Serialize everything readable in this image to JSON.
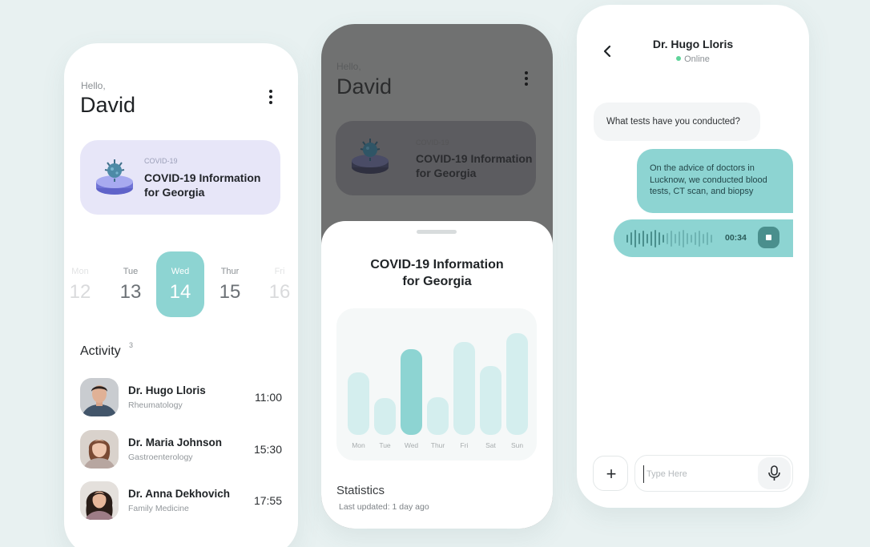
{
  "colors": {
    "accent": "#8dd4d2",
    "accent_dark": "#4a8f8d",
    "card_lavender": "#e7e6f8",
    "online": "#5fd49a",
    "background": "#e8f1f1"
  },
  "home": {
    "greeting": "Hello,",
    "user_name": "David",
    "menu_icon": "more-vertical-icon",
    "covid_card": {
      "icon": "virus-icon",
      "label": "COVID-19",
      "title": "COVID-19 Information for Georgia"
    },
    "days": [
      {
        "name": "Mon",
        "num": "12",
        "state": "faded"
      },
      {
        "name": "Tue",
        "num": "13",
        "state": "normal"
      },
      {
        "name": "Wed",
        "num": "14",
        "state": "active"
      },
      {
        "name": "Thur",
        "num": "15",
        "state": "normal"
      },
      {
        "name": "Fri",
        "num": "16",
        "state": "faded"
      }
    ],
    "activity": {
      "title": "Activity",
      "count": "3",
      "items": [
        {
          "name": "Dr. Hugo Lloris",
          "specialty": "Rheumatology",
          "time": "11:00"
        },
        {
          "name": "Dr. Maria Johnson",
          "specialty": "Gastroenterology",
          "time": "15:30"
        },
        {
          "name": "Dr. Anna Dekhovich",
          "specialty": "Family Medicine",
          "time": "17:55"
        }
      ]
    }
  },
  "sheet": {
    "title_line1": "COVID-19 Information",
    "title_line2": "for Georgia",
    "stats_title": "Statistics",
    "stats_updated": "Last updated: 1 day ago"
  },
  "chart_data": {
    "type": "bar",
    "categories": [
      "Mon",
      "Tue",
      "Wed",
      "Thur",
      "Fri",
      "Sat",
      "Sun"
    ],
    "values": [
      78,
      46,
      107,
      47,
      116,
      86,
      127
    ],
    "highlight": "Wed",
    "title": "",
    "xlabel": "",
    "ylabel": "",
    "grid": false
  },
  "chat": {
    "back_icon": "chevron-left-icon",
    "contact_name": "Dr. Hugo Lloris",
    "status": "Online",
    "messages": [
      {
        "from": "doctor",
        "text": "What tests have you conducted?"
      },
      {
        "from": "me",
        "text": "On the advice of doctors in Lucknow, we conducted blood tests, CT scan, and biopsy"
      }
    ],
    "voice_message": {
      "duration": "00:34",
      "icon": "stop-icon",
      "waveform": [
        10,
        16,
        22,
        14,
        20,
        12,
        18,
        22,
        16,
        10,
        14,
        20,
        12,
        18,
        22,
        14,
        10,
        16,
        20,
        12,
        16,
        10
      ]
    },
    "add_icon": "plus-icon",
    "input_placeholder": "Type Here",
    "mic_icon": "microphone-icon"
  }
}
